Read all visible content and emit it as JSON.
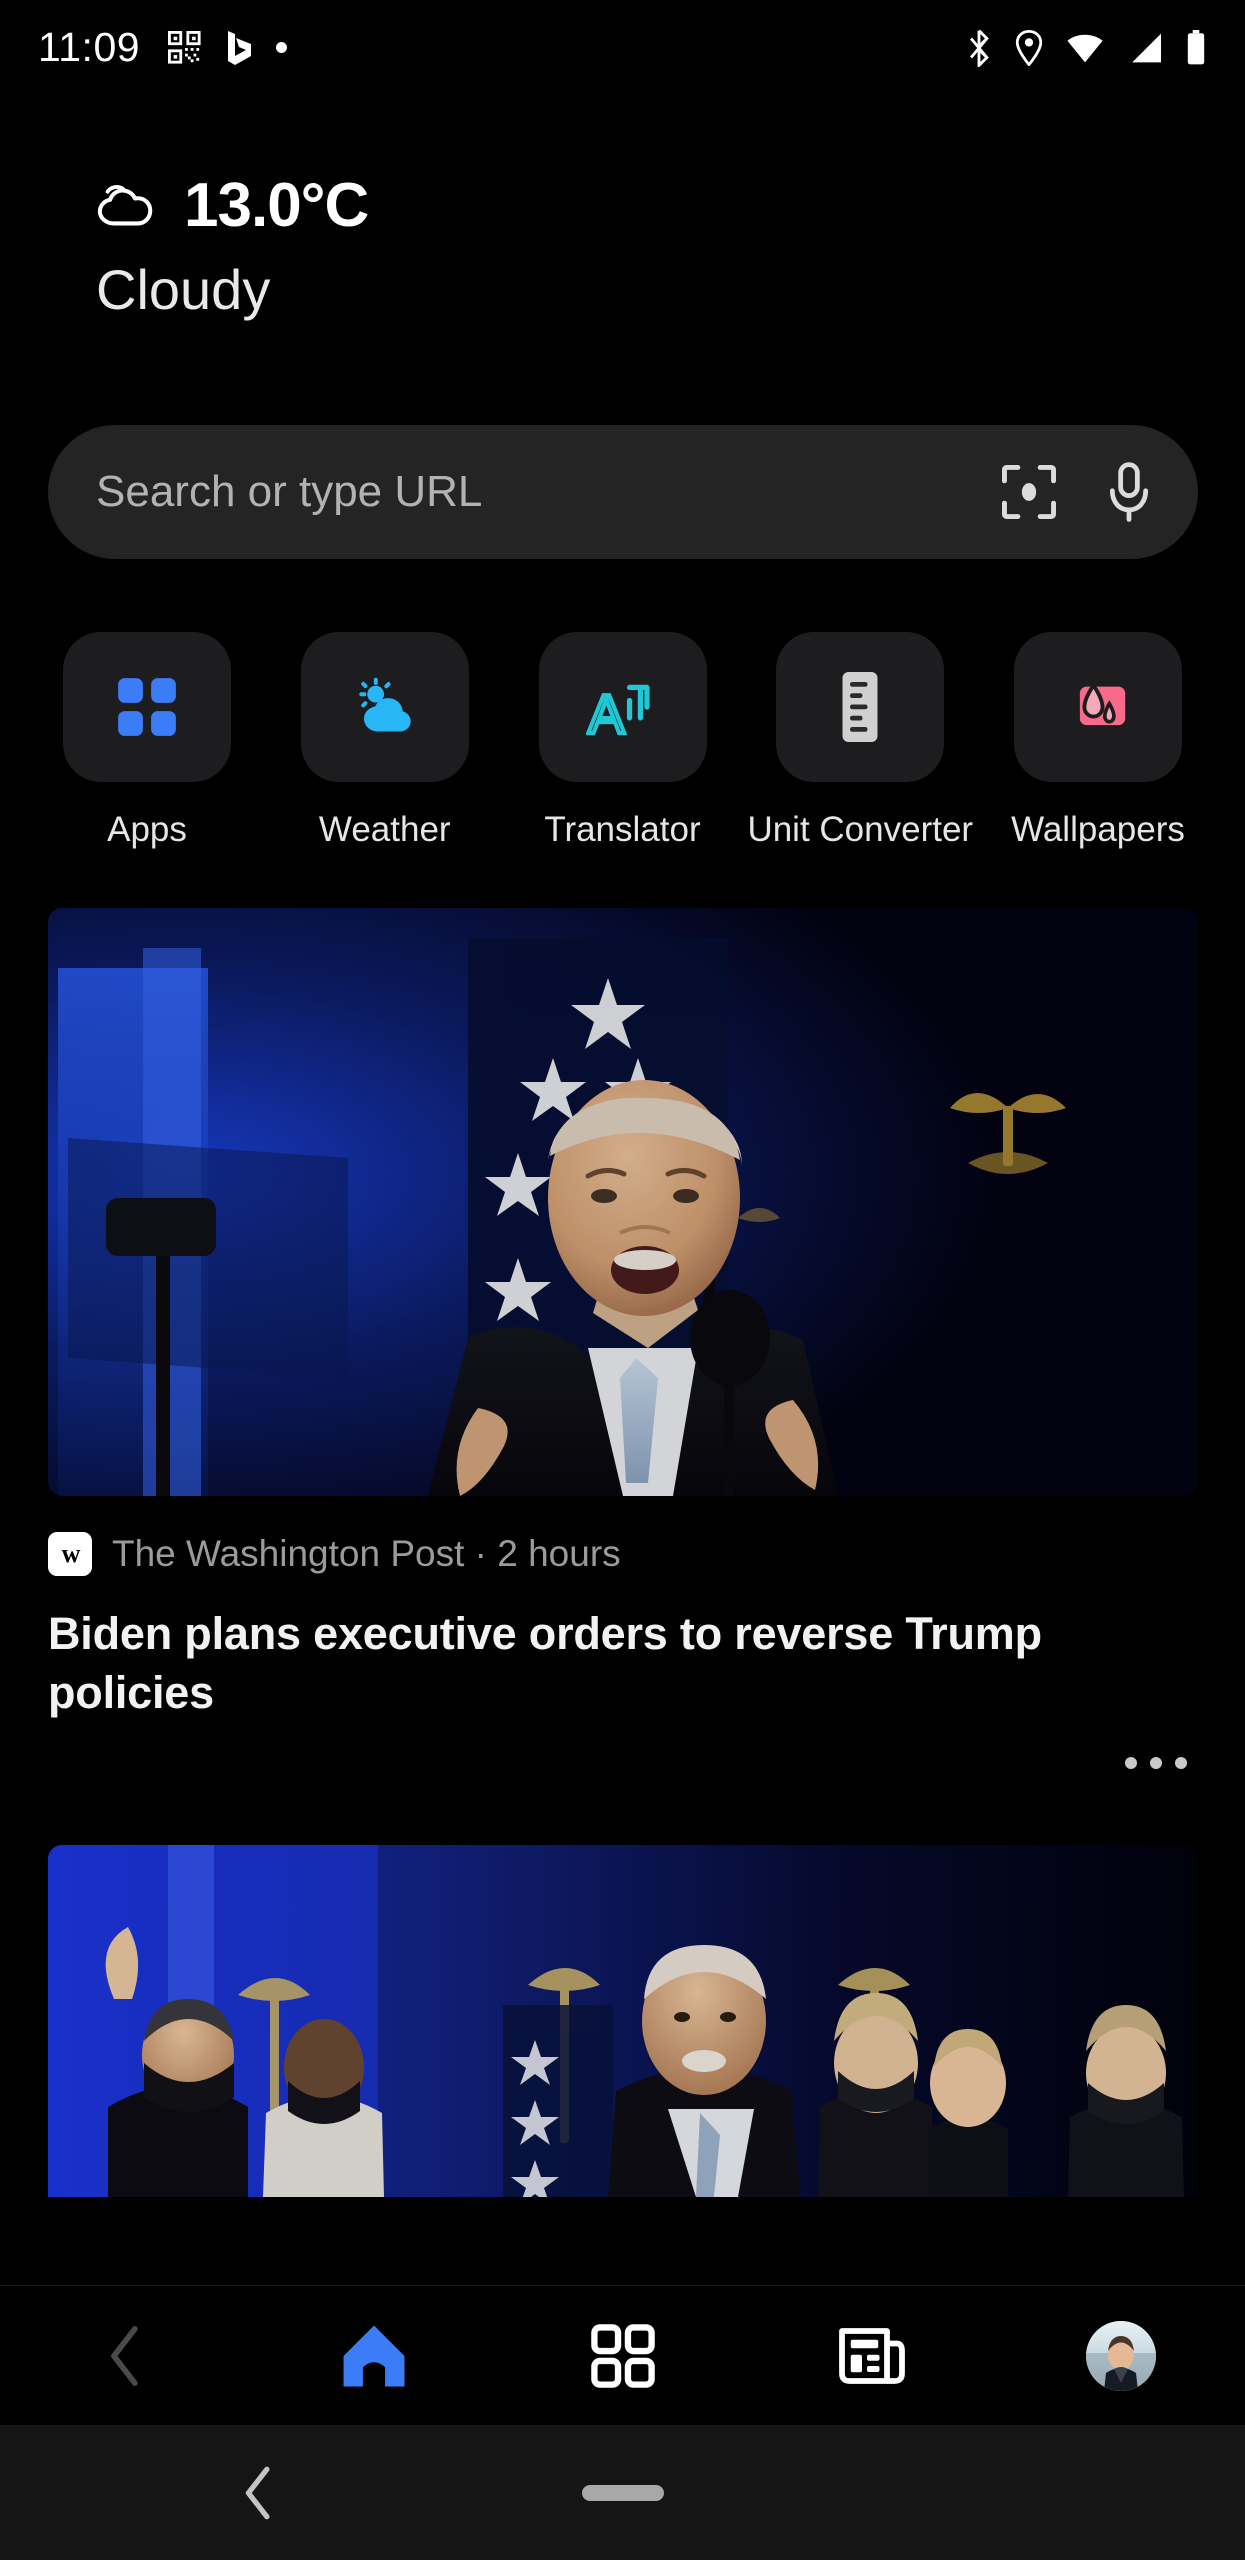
{
  "status_bar": {
    "time": "11:09",
    "left_icons": [
      "qr-code-icon",
      "bing-logo-icon",
      "dot-indicator-icon"
    ],
    "right_icons": [
      "bluetooth-icon",
      "location-pin-icon",
      "wifi-icon",
      "cellular-signal-icon",
      "battery-icon"
    ]
  },
  "weather": {
    "icon": "cloud-icon",
    "temperature": "13.0°C",
    "condition": "Cloudy"
  },
  "search": {
    "placeholder": "Search or type URL",
    "lens_icon": "visual-search-icon",
    "mic_icon": "microphone-icon"
  },
  "shortcuts": [
    {
      "label": "Apps",
      "icon": "apps-grid-icon",
      "color": "#3b7df6"
    },
    {
      "label": "Weather",
      "icon": "sun-cloud-icon",
      "color": "#29b6f6"
    },
    {
      "label": "Translator",
      "icon": "translate-icon",
      "color": "#21c7d4"
    },
    {
      "label": "Unit Converter",
      "icon": "ruler-icon",
      "color": "#d0d0d0"
    },
    {
      "label": "Wallpapers",
      "icon": "wallpaper-image-icon",
      "color": "#f86a8a"
    }
  ],
  "feed": {
    "articles": [
      {
        "source": "The Washington Post",
        "source_logo": "washington-post-logo",
        "time": "2 hours",
        "meta_line": "The Washington Post · 2 hours",
        "title": "Biden plans executive orders to reverse Trump policies",
        "image_alt": "Joe Biden speaking at podium with American flag",
        "overflow_icon": "more-options-icon"
      },
      {
        "image_alt": "Biden family and supporters on stage at night celebration"
      }
    ]
  },
  "bottom_nav": [
    {
      "name": "back",
      "icon": "chevron-left-icon",
      "active": false
    },
    {
      "name": "home",
      "icon": "home-icon",
      "active": true
    },
    {
      "name": "tabs",
      "icon": "grid-tabs-icon",
      "active": false
    },
    {
      "name": "news",
      "icon": "news-feed-icon",
      "active": false
    },
    {
      "name": "profile",
      "icon": "avatar-icon",
      "active": false
    }
  ],
  "system_nav": {
    "back_icon": "system-back-icon",
    "home_pill": "home-gesture-pill"
  },
  "colors": {
    "background": "#000000",
    "surface": "#1d1d1f",
    "search_bg": "#242424",
    "accent": "#3b7df6",
    "text_primary": "#f2f2f2",
    "text_secondary": "#9b9b9b"
  }
}
